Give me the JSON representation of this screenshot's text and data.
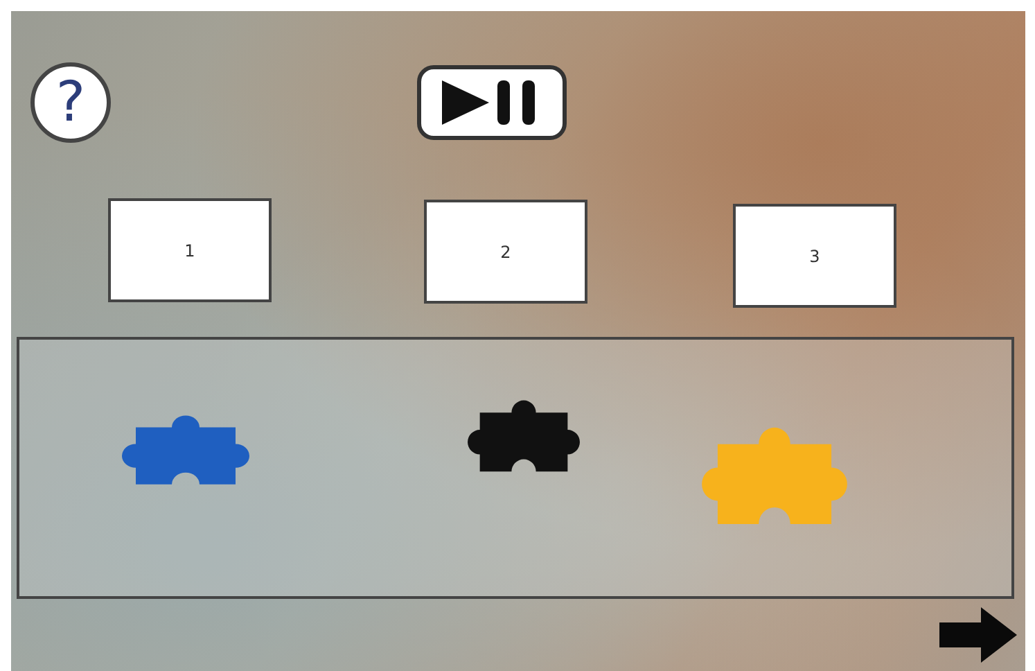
{
  "help_button": {
    "label": "?"
  },
  "slots": [
    {
      "label": "1"
    },
    {
      "label": "2"
    },
    {
      "label": "3"
    }
  ],
  "pieces": [
    {
      "color": "#1f5fc0"
    },
    {
      "color": "#111111"
    },
    {
      "color": "#f7b21c"
    }
  ]
}
